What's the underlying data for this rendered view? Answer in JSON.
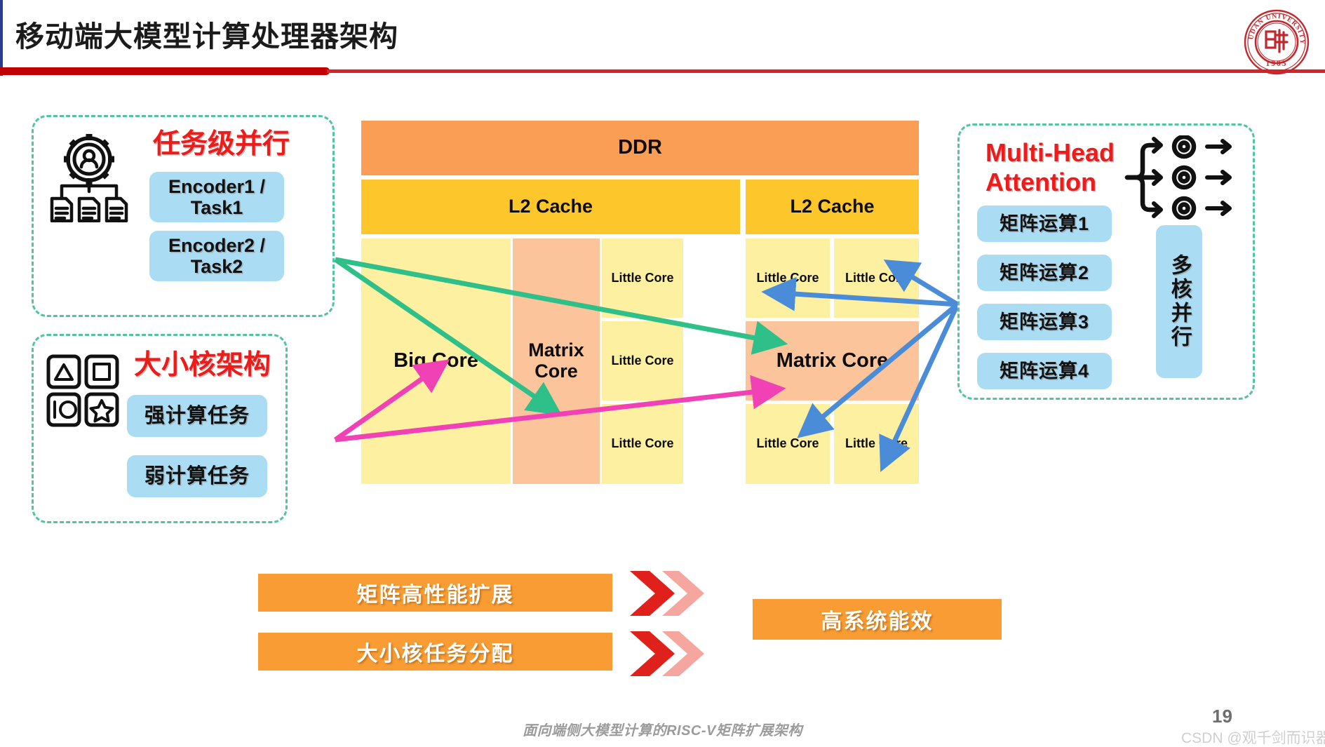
{
  "header": {
    "title": "移动端大模型计算处理器架构",
    "logo_name": "Fudan University",
    "logo_year": "1905"
  },
  "panels": {
    "task_parallel": {
      "title": "任务级并行",
      "icon": "gear-person-documents-icon",
      "items": [
        "Encoder1 /\nTask1",
        "Encoder2 /\nTask2"
      ]
    },
    "big_little": {
      "title": "大小核架构",
      "icon": "shapes-grid-icon",
      "items": [
        "强计算任务",
        "弱计算任务"
      ]
    },
    "attention": {
      "title": "Multi-Head\nAttention",
      "icon": "branch-gears-arrows-icon",
      "items": [
        "矩阵运算1",
        "矩阵运算2",
        "矩阵运算3",
        "矩阵运算4"
      ],
      "side_label": "多核并行"
    }
  },
  "soc": {
    "ddr": "DDR",
    "cluster_left": {
      "l2": "L2 Cache",
      "big_core": "Big Core",
      "matrix_core": "Matrix\nCore",
      "little_cores": [
        "Little Core",
        "Little Core",
        "Little Core"
      ]
    },
    "cluster_right": {
      "l2": "L2 Cache",
      "matrix_core": "Matrix Core",
      "little_cores": [
        "Little Core",
        "Little Core",
        "Little Core",
        "Little Core"
      ]
    }
  },
  "summary": {
    "inputs": [
      "矩阵高性能扩展",
      "大小核任务分配"
    ],
    "output": "高系统能效",
    "arrow_name": "double-chevron-icon"
  },
  "footer": {
    "caption": "面向端侧大模型计算的RISC-V矩阵扩展架构",
    "page": "19",
    "watermark": "CSDN @观千剑而识器"
  },
  "colors": {
    "title_red": "#c00000",
    "panel_border": "#54c4a0",
    "panel_title_red": "#ee1b1b",
    "blue_box": "#aadcf4",
    "ddr_orange": "#fb9e55",
    "l2_yellow": "#fdc72c",
    "core_yellow": "#fdf0a1",
    "matrix_peach": "#fbc49a",
    "bar_orange": "#f89c33",
    "arrow_green": "#2fc08a",
    "arrow_pink": "#f042b4",
    "arrow_blue": "#4a8cd8",
    "chevron_dark": "#e0201b",
    "chevron_light": "#f5a79f"
  }
}
